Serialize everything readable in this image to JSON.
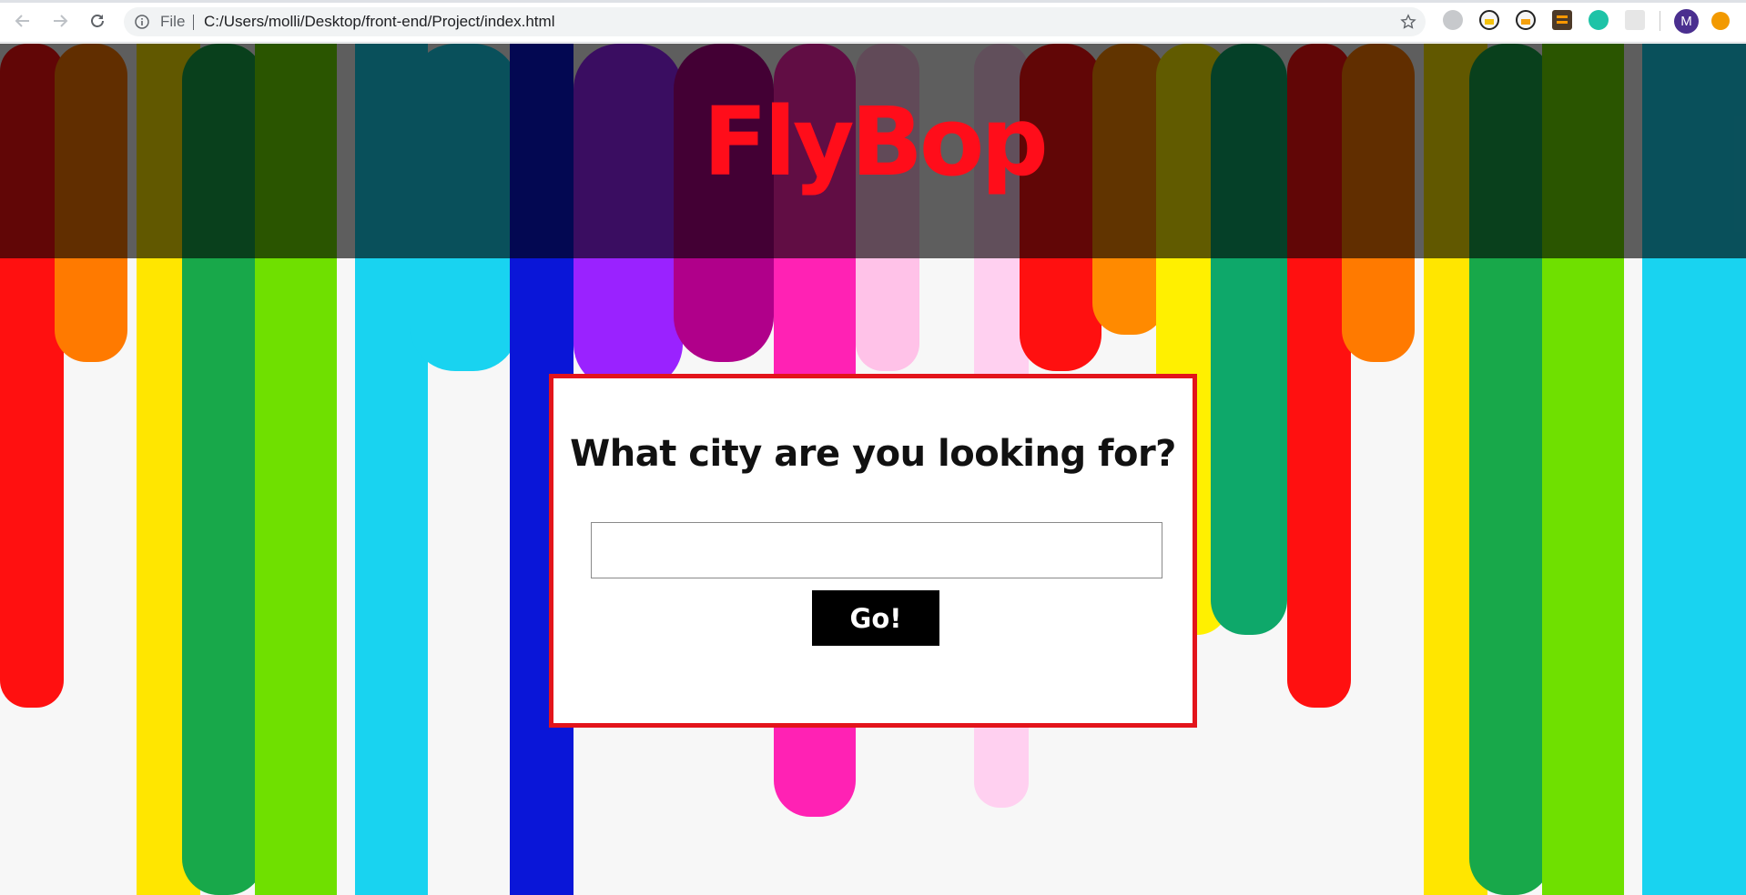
{
  "browser": {
    "scheme_label": "File",
    "url": "C:/Users/molli/Desktop/front-end/Project/index.html",
    "profile_initial": "M",
    "icons": {
      "back": "arrow-left-icon",
      "forward": "arrow-right-icon",
      "reload": "reload-icon",
      "info": "info-icon",
      "bookmark": "star-icon",
      "extensions": [
        "discord-extension-icon",
        "bee-extension-icon",
        "bee-extension-icon-2",
        "sublime-extension-icon",
        "w-extension-icon",
        "image-extension-icon"
      ],
      "update": "update-icon"
    }
  },
  "page": {
    "site_title": "FlyBop",
    "search": {
      "question": "What city are you looking for?",
      "input_value": "",
      "input_placeholder": "",
      "button_label": "Go!"
    }
  },
  "colors": {
    "title_red": "#ff0d1a",
    "card_border": "#e3141b",
    "button_bg": "#000000",
    "header_overlay": "rgba(0,0,0,0.62)"
  }
}
